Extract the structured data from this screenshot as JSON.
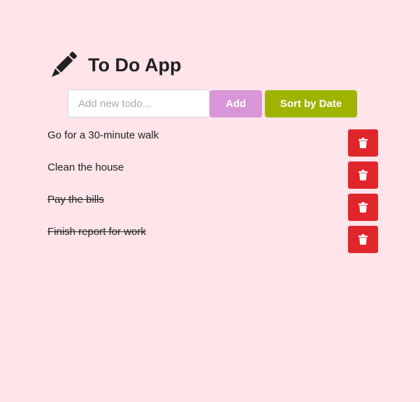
{
  "app": {
    "title": "To Do App",
    "icon": "pencil-icon"
  },
  "form": {
    "input_value": "",
    "input_placeholder": "Add new todo...",
    "add_label": "Add",
    "sort_label": "Sort by Date"
  },
  "colors": {
    "background": "#ffe4ea",
    "add_button": "#d896d9",
    "sort_button": "#9fb400",
    "delete_button": "#e0262b"
  },
  "todos": [
    {
      "text": "Go for a 30-minute walk",
      "completed": false,
      "delete_icon": "trash-icon"
    },
    {
      "text": "Clean the house",
      "completed": false,
      "delete_icon": "trash-icon"
    },
    {
      "text": "Pay the bills",
      "completed": true,
      "delete_icon": "trash-icon"
    },
    {
      "text": "Finish report for work",
      "completed": true,
      "delete_icon": "trash-icon"
    }
  ]
}
